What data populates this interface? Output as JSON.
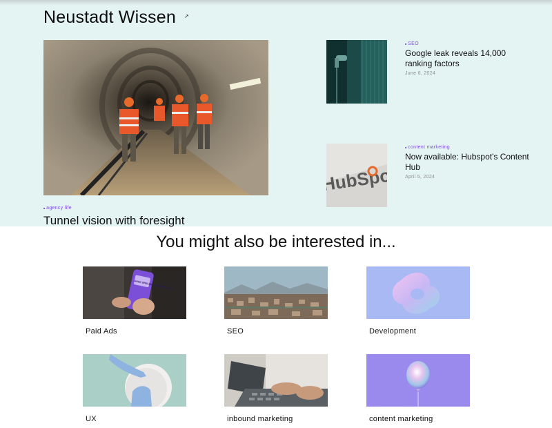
{
  "site": {
    "brand": "Neustadt Wissen",
    "brand_mark": "↗"
  },
  "featured": {
    "tag": "agency life",
    "title": "Tunnel vision with foresight",
    "image_icon": "tunnel-workers-photo"
  },
  "side_posts": [
    {
      "tag": "SEO",
      "title": "Google leak reveals 14,000 ranking factors",
      "date": "June 6, 2024",
      "image_icon": "water-tap-photo"
    },
    {
      "tag": "content marketing",
      "title": "Now available: Hubspot's Content Hub",
      "date": "April 5, 2024",
      "image_icon": "hubspot-logo-photo",
      "logo_text": "HubSpot"
    }
  ],
  "related": {
    "heading": "You might also be interested in...",
    "topics": [
      {
        "label": "Paid Ads",
        "image_icon": "phone-in-hand-photo",
        "phone_text": "ANGE SPIELEN. ANGE SPIELEN"
      },
      {
        "label": "SEO",
        "image_icon": "city-landscape-photo"
      },
      {
        "label": "Development",
        "image_icon": "abstract-3d-shape"
      },
      {
        "label": "UX",
        "image_icon": "hand-touching-disc"
      },
      {
        "label": "inbound marketing",
        "image_icon": "typing-laptop-photo"
      },
      {
        "label": "content marketing",
        "image_icon": "iridescent-balloon"
      }
    ]
  },
  "colors": {
    "hero_bg": "#e4f4f2",
    "tag": "#7b4fd8",
    "text": "#111111",
    "date": "#8a8f8f"
  }
}
